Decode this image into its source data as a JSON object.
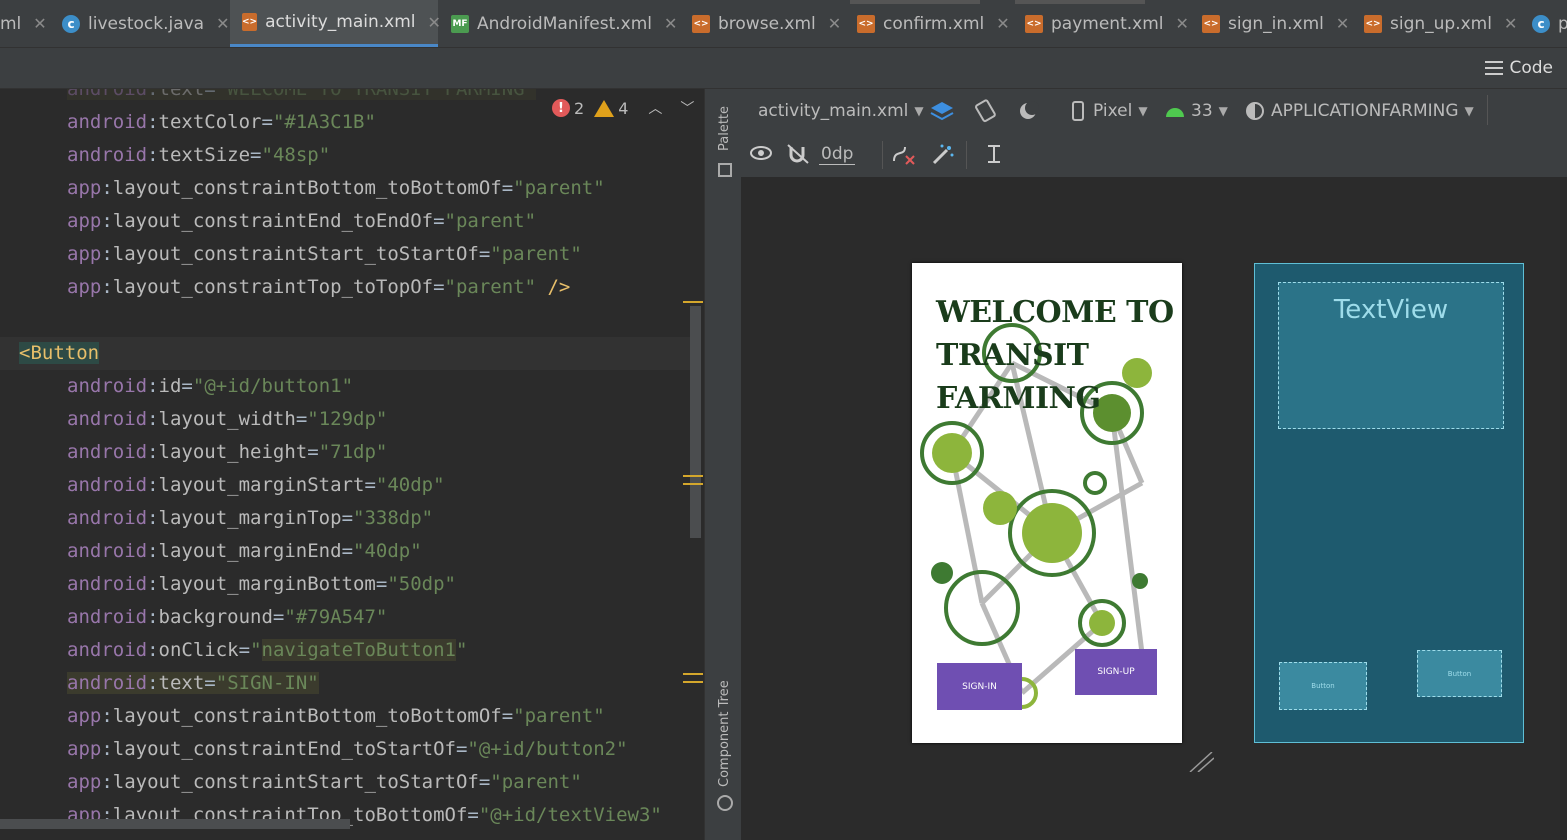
{
  "tabs": [
    {
      "label": "ml",
      "icon": "none"
    },
    {
      "label": "livestock.java",
      "icon": "java-class-icon"
    },
    {
      "label": "activity_main.xml",
      "icon": "xml-file-icon",
      "active": true
    },
    {
      "label": "AndroidManifest.xml",
      "icon": "manifest-file-icon"
    },
    {
      "label": "browse.xml",
      "icon": "xml-file-icon"
    },
    {
      "label": "confirm.xml",
      "icon": "xml-file-icon"
    },
    {
      "label": "payment.xml",
      "icon": "xml-file-icon"
    },
    {
      "label": "sign_in.xml",
      "icon": "xml-file-icon"
    },
    {
      "label": "sign_up.xml",
      "icon": "xml-file-icon"
    },
    {
      "label": "p",
      "icon": "java-class-icon"
    }
  ],
  "view_mode": {
    "code_label": "Code"
  },
  "inspections": {
    "errors": "2",
    "warnings": "4"
  },
  "code": {
    "line0": {
      "ns": "android",
      "attr": "text",
      "val": "\"WELCOME TO TRANSIT FARMING\""
    },
    "line1": {
      "ns": "android",
      "attr": "textColor",
      "val": "\"#1A3C1B\""
    },
    "line2": {
      "ns": "android",
      "attr": "textSize",
      "val": "\"48sp\""
    },
    "line3": {
      "ns": "app",
      "attr": "layout_constraintBottom_toBottomOf",
      "val": "\"parent\""
    },
    "line4": {
      "ns": "app",
      "attr": "layout_constraintEnd_toEndOf",
      "val": "\"parent\""
    },
    "line5": {
      "ns": "app",
      "attr": "layout_constraintStart_toStartOf",
      "val": "\"parent\""
    },
    "line6": {
      "ns": "app",
      "attr": "layout_constraintTop_toTopOf",
      "val": "\"parent\"",
      "tail": " />"
    },
    "tag_open": "<Button",
    "line8": {
      "ns": "android",
      "attr": "id",
      "val": "\"@+id/button1\""
    },
    "line9": {
      "ns": "android",
      "attr": "layout_width",
      "val": "\"129dp\""
    },
    "line10": {
      "ns": "android",
      "attr": "layout_height",
      "val": "\"71dp\""
    },
    "line11": {
      "ns": "android",
      "attr": "layout_marginStart",
      "val": "\"40dp\""
    },
    "line12": {
      "ns": "android",
      "attr": "layout_marginTop",
      "val": "\"338dp\""
    },
    "line13": {
      "ns": "android",
      "attr": "layout_marginEnd",
      "val": "\"40dp\""
    },
    "line14": {
      "ns": "android",
      "attr": "layout_marginBottom",
      "val": "\"50dp\""
    },
    "line15": {
      "ns": "android",
      "attr": "background",
      "val": "\"#79A547\""
    },
    "line16": {
      "ns": "android",
      "attr": "onClick",
      "val_q1": "\"",
      "val_hl": "navigateToButton1",
      "val_q2": "\""
    },
    "line17": {
      "ns": "android",
      "attr": "text",
      "val": "\"SIGN-IN\""
    },
    "line18": {
      "ns": "app",
      "attr": "layout_constraintBottom_toBottomOf",
      "val": "\"parent\""
    },
    "line19": {
      "ns": "app",
      "attr": "layout_constraintEnd_toStartOf",
      "val": "\"@+id/button2\""
    },
    "line20": {
      "ns": "app",
      "attr": "layout_constraintStart_toStartOf",
      "val": "\"parent\""
    },
    "line21": {
      "ns": "app",
      "attr": "layout_constraintTop_toBottomOf",
      "val": "\"@+id/textView3\""
    }
  },
  "side_panels": {
    "palette": "Palette",
    "component_tree": "Component Tree"
  },
  "design_toolbar": {
    "file": "activity_main.xml",
    "device": "Pixel",
    "api": "33",
    "theme": "APPLICATIONFARMING",
    "margin": "0dp"
  },
  "preview": {
    "welcome_text": "WELCOME TO TRANSIT FARMING",
    "signin_label": "SIGN-IN",
    "signup_label": "SIGN-UP",
    "text_color": "#1A3C1B",
    "button_color": "#6F4FB2"
  },
  "blueprint": {
    "textview_label": "TextView",
    "button1_label": "Button",
    "button2_label": "Button"
  }
}
